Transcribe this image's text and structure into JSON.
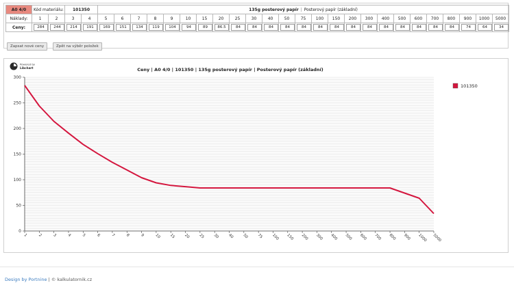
{
  "header": {
    "badge": "A0 4/0",
    "material_label": "Kód materiálu:",
    "material_code": "101350",
    "material_name_bold": "135g posterový papír",
    "material_separator": "|",
    "material_name_rest": "Posterový papír (základní)"
  },
  "table": {
    "row_labels": {
      "quantities": "Náklady:",
      "prices": "Ceny:"
    },
    "quantities": [
      "1",
      "2",
      "3",
      "4",
      "5",
      "6",
      "7",
      "8",
      "9",
      "10",
      "15",
      "20",
      "25",
      "30",
      "40",
      "50",
      "75",
      "100",
      "150",
      "200",
      "300",
      "400",
      "500",
      "600",
      "700",
      "800",
      "900",
      "1000",
      "5000"
    ],
    "prices": [
      "284",
      "244",
      "214",
      "191",
      "169",
      "151",
      "134",
      "119",
      "104",
      "94",
      "89",
      "86.5",
      "84",
      "84",
      "84",
      "84",
      "84",
      "84",
      "84",
      "84",
      "84",
      "84",
      "84",
      "84",
      "84",
      "84",
      "74",
      "64",
      "34"
    ]
  },
  "buttons": {
    "save": "Zapsat nové ceny",
    "back": "Zpět na výběr položek"
  },
  "chart_logo": {
    "line1": "Powered by",
    "line2": "Libchart"
  },
  "chart_title_parts": [
    "Ceny",
    "A0 4/0",
    "101350",
    "135g posterový papír",
    "Posterový papír (základní)"
  ],
  "chart_title_separator": "|",
  "colors": {
    "series": "#d4163e",
    "badge": "#e8897f",
    "link": "#3a7bbf"
  },
  "chart_data": {
    "type": "line",
    "title": "Ceny | A0 4/0 | 101350 | 135g posterový papír | Posterový papír (základní)",
    "categories": [
      "1",
      "2",
      "3",
      "4",
      "5",
      "6",
      "7",
      "8",
      "9",
      "10",
      "15",
      "20",
      "25",
      "30",
      "40",
      "50",
      "75",
      "100",
      "150",
      "200",
      "300",
      "400",
      "500",
      "600",
      "700",
      "800",
      "900",
      "1000",
      "5000"
    ],
    "series": [
      {
        "name": "101350",
        "values": [
          284,
          244,
          214,
          191,
          169,
          151,
          134,
          119,
          104,
          94,
          89,
          86.5,
          84,
          84,
          84,
          84,
          84,
          84,
          84,
          84,
          84,
          84,
          84,
          84,
          84,
          84,
          74,
          64,
          34
        ]
      }
    ],
    "ylim": [
      0,
      300
    ],
    "yticks": [
      0,
      50,
      100,
      150,
      200,
      250,
      300
    ],
    "grid": true,
    "legend": "right"
  },
  "footer": {
    "link": "Design by Portnine",
    "separator": "|",
    "copyright": "© kalkulatornik.cz"
  }
}
